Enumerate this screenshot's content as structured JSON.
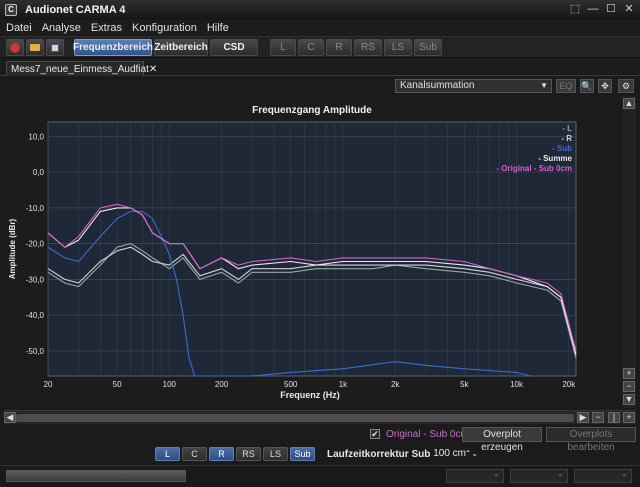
{
  "app": {
    "title": "Audionet CARMA 4",
    "icon": "C"
  },
  "window_controls": [
    "⬚",
    "—",
    "☐",
    "✕"
  ],
  "menu": [
    "Datei",
    "Analyse",
    "Extras",
    "Konfiguration",
    "Hilfe"
  ],
  "toolbar": {
    "views": [
      {
        "label": "Frequenzbereich",
        "active": true
      },
      {
        "label": "Zeitbereich",
        "active": false
      },
      {
        "label": "CSD",
        "active": false
      }
    ],
    "channels": [
      "L",
      "C",
      "R",
      "RS",
      "LS",
      "Sub"
    ]
  },
  "document_tab": {
    "label": "Mess7_neue_Einmess_Audfiat",
    "close": "✕"
  },
  "viewbar": {
    "select_value": "Kanalsummation",
    "eq_label": "EQ"
  },
  "chart_data": {
    "type": "line",
    "title": "Frequenzgang Amplitude",
    "xlabel": "Frequenz (Hz)",
    "ylabel": "Amplitude (dBr)",
    "x_scale": "log",
    "xlim": [
      20,
      22000
    ],
    "ylim": [
      -57,
      14
    ],
    "x_ticks": [
      20,
      50,
      100,
      200,
      500,
      1000,
      2000,
      5000,
      10000,
      20000
    ],
    "x_tick_labels": [
      "20",
      "50",
      "100",
      "200",
      "500",
      "1k",
      "2k",
      "5k",
      "10k",
      "20k"
    ],
    "y_ticks": [
      10,
      0,
      -10,
      -20,
      -30,
      -40,
      -50
    ],
    "y_tick_labels": [
      "10,0",
      "0,0",
      "-10,0",
      "-20,0",
      "-30,0",
      "-40,0",
      "-50,0"
    ],
    "legend_position": "top-right",
    "grid": true,
    "series": [
      {
        "name": "- L",
        "color": "#9aa6a6",
        "x": [
          20,
          25,
          30,
          40,
          50,
          60,
          70,
          80,
          100,
          120,
          150,
          200,
          250,
          300,
          500,
          700,
          1000,
          1500,
          2000,
          3000,
          5000,
          7000,
          10000,
          15000,
          18000,
          22000
        ],
        "y": [
          -28,
          -31,
          -32,
          -26,
          -21,
          -20,
          -22,
          -24,
          -27,
          -24,
          -30,
          -28,
          -31,
          -28,
          -28,
          -27,
          -27,
          -27,
          -26,
          -27,
          -28,
          -29,
          -31,
          -33,
          -36,
          -52
        ]
      },
      {
        "name": "- R",
        "color": "#d4d4d4",
        "x": [
          20,
          25,
          30,
          40,
          50,
          60,
          70,
          80,
          100,
          120,
          150,
          200,
          250,
          300,
          500,
          700,
          1000,
          1500,
          2000,
          3000,
          5000,
          7000,
          10000,
          15000,
          18000,
          22000
        ],
        "y": [
          -27,
          -30,
          -31,
          -25,
          -22,
          -21,
          -23,
          -25,
          -26,
          -23,
          -29,
          -27,
          -30,
          -27,
          -27,
          -26,
          -26,
          -26,
          -26,
          -26,
          -27,
          -28,
          -30,
          -32,
          -35,
          -50
        ]
      },
      {
        "name": "- Sub",
        "color": "#3d6bd6",
        "x": [
          20,
          25,
          30,
          40,
          50,
          60,
          70,
          80,
          90,
          100,
          110,
          120,
          130,
          140,
          150,
          200,
          300,
          500,
          1000,
          2000,
          3000,
          5000,
          10000,
          12000
        ],
        "y": [
          -21,
          -24,
          -25,
          -18,
          -13,
          -11,
          -11,
          -13,
          -18,
          -23,
          -30,
          -40,
          -52,
          -57,
          -57,
          -57,
          -57,
          -56,
          -55,
          -53,
          -54,
          -55,
          -56,
          -57
        ]
      },
      {
        "name": "- Summe",
        "color": "#ececec",
        "x": [
          20,
          25,
          30,
          40,
          50,
          60,
          70,
          80,
          100,
          120,
          150,
          200,
          250,
          300,
          500,
          700,
          1000,
          1500,
          2000,
          3000,
          5000,
          7000,
          10000,
          15000,
          18000,
          22000
        ],
        "y": [
          -17,
          -21,
          -19,
          -11,
          -10,
          -10,
          -12,
          -17,
          -20,
          -20,
          -27,
          -24,
          -27,
          -26,
          -25,
          -26,
          -25,
          -25,
          -25,
          -25,
          -26,
          -27,
          -29,
          -32,
          -35,
          -51
        ]
      },
      {
        "name": "- Original - Sub 0cm",
        "color": "#d660cc",
        "x": [
          20,
          25,
          30,
          40,
          50,
          60,
          70,
          80,
          100,
          120,
          150,
          200,
          250,
          300,
          500,
          700,
          1000,
          1500,
          2000,
          3000,
          5000,
          7000,
          10000,
          15000,
          18000,
          22000
        ],
        "y": [
          -17,
          -21,
          -18,
          -10,
          -9,
          -10,
          -12,
          -17,
          -20,
          -20,
          -27,
          -24,
          -26,
          -25,
          -24,
          -25,
          -24,
          -24,
          -24,
          -24,
          -25,
          -27,
          -29,
          -31,
          -34,
          -50
        ]
      }
    ]
  },
  "overlay": {
    "checkbox_checked": true,
    "checkmark": "✔",
    "label": "Original - Sub 0cm",
    "create_button": "Overplot erzeugen",
    "edit_button": "Overplots bearbeiten"
  },
  "channel_bar": {
    "channels": [
      {
        "label": "L",
        "active": true
      },
      {
        "label": "C",
        "active": false
      },
      {
        "label": "R",
        "active": true
      },
      {
        "label": "RS",
        "active": false
      },
      {
        "label": "LS",
        "active": false
      },
      {
        "label": "Sub",
        "active": true
      }
    ],
    "delay_label": "Laufzeitkorrektur Sub",
    "delay_value": "100 cm"
  },
  "statusbar": {
    "progress": 1.0,
    "fields": [
      "-",
      "-",
      "-"
    ]
  }
}
